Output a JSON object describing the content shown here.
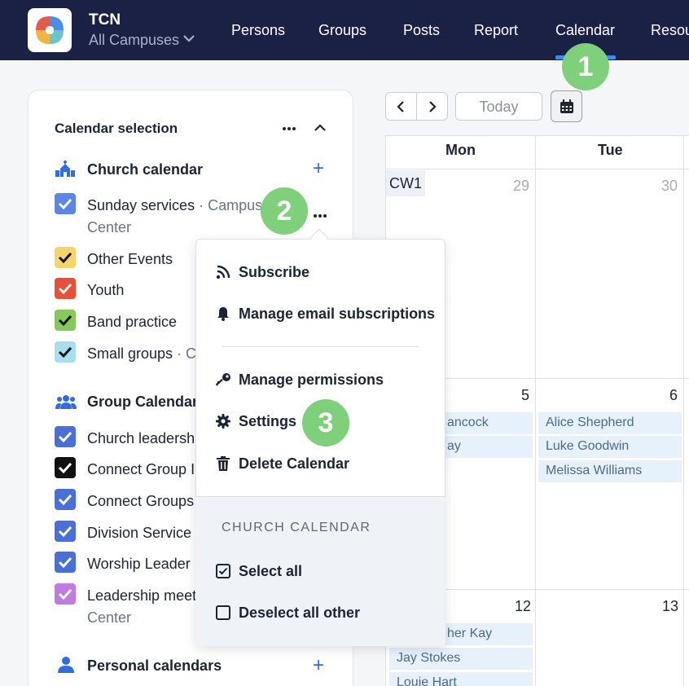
{
  "app": {
    "name": "TCN",
    "campus": "All Campuses"
  },
  "nav": {
    "items": [
      "Persons",
      "Groups",
      "Posts",
      "Report",
      "Calendar",
      "Resou"
    ],
    "active": "Calendar"
  },
  "badges": [
    "1",
    "2",
    "3"
  ],
  "sidebar": {
    "title": "Calendar selection",
    "church": {
      "heading": "Church calendar",
      "items": [
        {
          "label": "Sunday services",
          "suffix": " · Campus",
          "line2": "Center",
          "color": "#5b86e5"
        },
        {
          "label": "Other Events",
          "color": "#f5d56b"
        },
        {
          "label": "Youth",
          "color": "#e8503a"
        },
        {
          "label": "Band practice",
          "color": "#86c95a"
        },
        {
          "label": "Small groups",
          "suffix": " · C",
          "color": "#a8dff0"
        }
      ]
    },
    "groups": {
      "heading": "Group Calendar",
      "items": [
        {
          "label": "Church leadersh",
          "color": "#4a6fd8"
        },
        {
          "label": "Connect Group I",
          "color": "#111111"
        },
        {
          "label": "Connect Groups",
          "color": "#4a6fd8"
        },
        {
          "label": "Division Service",
          "color": "#4a6fd8"
        },
        {
          "label": "Worship Leader",
          "color": "#4a6fd8"
        },
        {
          "label": "Leadership meet",
          "line2": "Center",
          "color": "#c07be0"
        }
      ]
    },
    "personal": {
      "heading": "Personal calendars"
    }
  },
  "toolbar": {
    "today": "Today"
  },
  "calendar": {
    "days": [
      "Mon",
      "Tue"
    ],
    "week_label": "CW1",
    "dates": {
      "mon1": "29",
      "tue1": "30",
      "mon2": "5",
      "tue2": "6",
      "mon3": "12",
      "tue3": "13"
    },
    "events_mon2": [
      "ancock",
      "ay"
    ],
    "events_tue2": [
      "Alice Shepherd",
      "Luke Goodwin",
      "Melissa Williams"
    ],
    "events_mon3": [
      "her Kay",
      "Jay Stokes",
      "Louie Hart"
    ]
  },
  "menu": {
    "subscribe": "Subscribe",
    "manage_email": "Manage email subscriptions",
    "manage_permissions": "Manage permissions",
    "settings": "Settings",
    "delete": "Delete Calendar",
    "footer_title": "CHURCH CALENDAR",
    "select_all": "Select all",
    "deselect_others": "Deselect all other"
  }
}
